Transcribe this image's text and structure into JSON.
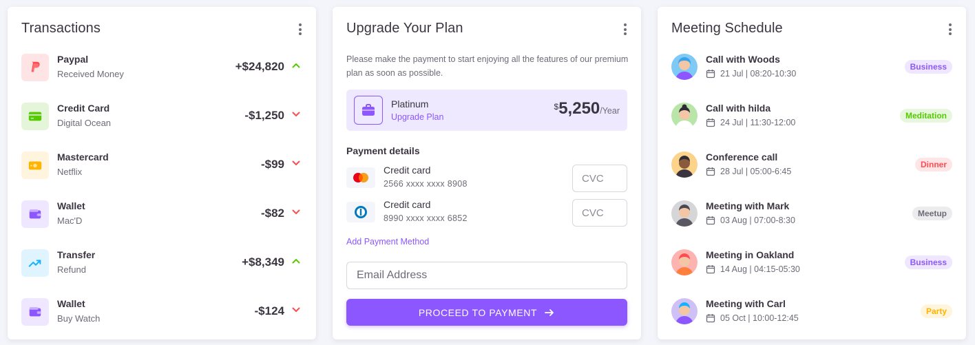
{
  "transactions": {
    "title": "Transactions",
    "items": [
      {
        "title": "Paypal",
        "subtitle": "Received Money",
        "amount": "+$24,820",
        "trend": "up",
        "icon": "paypal-icon",
        "color": "#ff4c51"
      },
      {
        "title": "Credit Card",
        "subtitle": "Digital Ocean",
        "amount": "-$1,250",
        "trend": "down",
        "icon": "credit-card-icon",
        "color": "#56ca00"
      },
      {
        "title": "Mastercard",
        "subtitle": "Netflix",
        "amount": "-$99",
        "trend": "down",
        "icon": "dollar-card-icon",
        "color": "#ffb400"
      },
      {
        "title": "Wallet",
        "subtitle": "Mac'D",
        "amount": "-$82",
        "trend": "down",
        "icon": "wallet-icon",
        "color": "#8c57ff"
      },
      {
        "title": "Transfer",
        "subtitle": "Refund",
        "amount": "+$8,349",
        "trend": "up",
        "icon": "trending-up-icon",
        "color": "#16b1ff"
      },
      {
        "title": "Wallet",
        "subtitle": "Buy Watch",
        "amount": "-$124",
        "trend": "down",
        "icon": "wallet-icon",
        "color": "#8c57ff"
      }
    ]
  },
  "upgrade": {
    "title": "Upgrade Your Plan",
    "description": "Please make the payment to start enjoying all the features of our premium plan as soon as possible.",
    "plan": {
      "name": "Platinum",
      "link": "Upgrade Plan",
      "currency": "$",
      "price": "5,250",
      "period": "/Year"
    },
    "payment_title": "Payment details",
    "methods": [
      {
        "title": "Credit card",
        "number": "2566 xxxx xxxx 8908",
        "logo": "mastercard-logo",
        "cvc_placeholder": "CVC"
      },
      {
        "title": "Credit card",
        "number": "8990 xxxx xxxx 6852",
        "logo": "diners-club-logo",
        "cvc_placeholder": "CVC"
      }
    ],
    "add_method": "Add Payment Method",
    "email_placeholder": "Email Address",
    "proceed_label": "PROCEED TO PAYMENT"
  },
  "meetings": {
    "title": "Meeting Schedule",
    "items": [
      {
        "title": "Call with Woods",
        "time": "21 Jul | 08:20-10:30",
        "badge": "Business",
        "badge_color": "#8c57ff",
        "badge_bg": "#efe7ff",
        "avatar_bg": "#7ec9f5"
      },
      {
        "title": "Call with hilda",
        "time": "24 Jul | 11:30-12:00",
        "badge": "Meditation",
        "badge_color": "#56ca00",
        "badge_bg": "#e6f7dd",
        "avatar_bg": "#b9e6a8"
      },
      {
        "title": "Conference call",
        "time": "28 Jul | 05:00-6:45",
        "badge": "Dinner",
        "badge_color": "#ff4c51",
        "badge_bg": "#ffe5e6",
        "avatar_bg": "#fcd38a"
      },
      {
        "title": "Meeting with Mark",
        "time": "03 Aug | 07:00-8:30",
        "badge": "Meetup",
        "badge_color": "#6d6b77",
        "badge_bg": "#ececee",
        "avatar_bg": "#d6d6d8"
      },
      {
        "title": "Meeting in Oakland",
        "time": "14 Aug | 04:15-05:30",
        "badge": "Business",
        "badge_color": "#8c57ff",
        "badge_bg": "#efe7ff",
        "avatar_bg": "#fdb4b0"
      },
      {
        "title": "Meeting with Carl",
        "time": "05 Oct | 10:00-12:45",
        "badge": "Party",
        "badge_color": "#ffb400",
        "badge_bg": "#fff4dc",
        "avatar_bg": "#cfc0f5"
      }
    ]
  }
}
